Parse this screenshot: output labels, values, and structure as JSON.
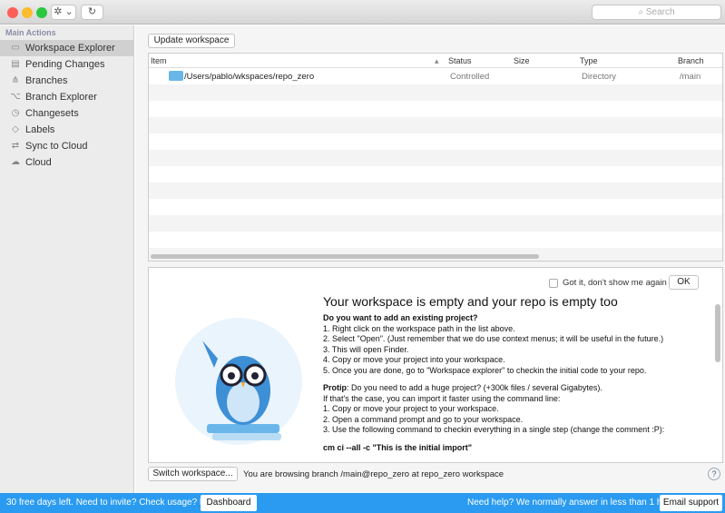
{
  "toolbar": {
    "search_placeholder": "Search",
    "gear": "✲ ⌄",
    "refresh": "↻"
  },
  "sidebar": {
    "header": "Main Actions",
    "items": [
      {
        "label": "Workspace Explorer",
        "icon": "folder-icon"
      },
      {
        "label": "Pending Changes",
        "icon": "pending-changes-icon"
      },
      {
        "label": "Branches",
        "icon": "branches-icon"
      },
      {
        "label": "Branch Explorer",
        "icon": "branch-explorer-icon"
      },
      {
        "label": "Changesets",
        "icon": "history-icon"
      },
      {
        "label": "Labels",
        "icon": "tag-icon"
      },
      {
        "label": "Sync to Cloud",
        "icon": "sync-icon"
      },
      {
        "label": "Cloud",
        "icon": "cloud-icon"
      }
    ]
  },
  "main": {
    "update_label": "Update workspace",
    "table": {
      "headers": [
        "Item",
        "Status",
        "Size",
        "Type",
        "Branch"
      ],
      "rows": [
        {
          "item": "/Users/pablo/wkspaces/repo_zero",
          "status": "Controlled",
          "size": "",
          "type": "Directory",
          "branch": "/main"
        }
      ]
    },
    "panel": {
      "got_it": "Got it, don't show me again",
      "ok": "OK",
      "title": "Your workspace is empty and your repo is empty too",
      "q1": "Do you want to add an existing project?",
      "steps1": [
        "1. Right click on the workspace path in the list above.",
        "2. Select \"Open\". (Just remember that we do use context menus; it will be useful in the future.)",
        "3. This will open Finder.",
        "4. Copy or move your project into your workspace.",
        "5. Once you are done, go to \"Workspace explorer\" to checkin the initial code to your repo."
      ],
      "protip_label": "Protip",
      "protip": ": Do you need to add a huge project? (+300k files / several Gigabytes).",
      "steps2": [
        "If that's the case, you can import it faster using the command line:",
        "1. Copy or move your project to your workspace.",
        "2. Open a command prompt and go to your workspace.",
        "3. Use the following command to checkin everything in a single step (change the comment :P):"
      ],
      "command": "cm ci --all -c \"This is the initial import\""
    },
    "switch_label": "Switch workspace...",
    "browsing": "You are browsing branch /main@repo_zero at repo_zero workspace",
    "help": "?"
  },
  "footer": {
    "trial": "30 free days left. Need to invite? Check usage? Pay?",
    "dashboard": "Dashboard",
    "help_text": "Need help? We normally answer in less than 1 hour!",
    "email": "Email support"
  },
  "colors": {
    "accent": "#2a9bf0"
  }
}
